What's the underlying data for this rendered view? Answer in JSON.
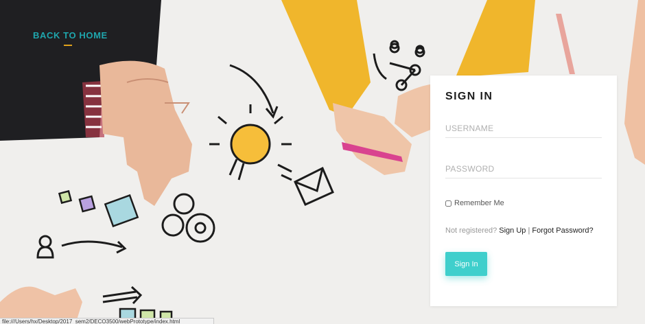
{
  "nav": {
    "back_label": "BACK TO HOME"
  },
  "signin": {
    "title": "SIGN IN",
    "username_placeholder": "USERNAME",
    "password_placeholder": "PASSWORD",
    "remember_label": "Remember Me",
    "not_registered": "Not registered?",
    "signup_label": "Sign Up",
    "separator": "|",
    "forgot_label": "Forgot Password?",
    "button_label": "Sign In"
  },
  "statusbar": {
    "url": "file:///Users/hx/Desktop/2017_sem2/DECO3500/webPrototype/index.html"
  },
  "colors": {
    "accent": "#3fcfcc",
    "link": "#1fa6ad",
    "underline": "#e0a21b"
  }
}
